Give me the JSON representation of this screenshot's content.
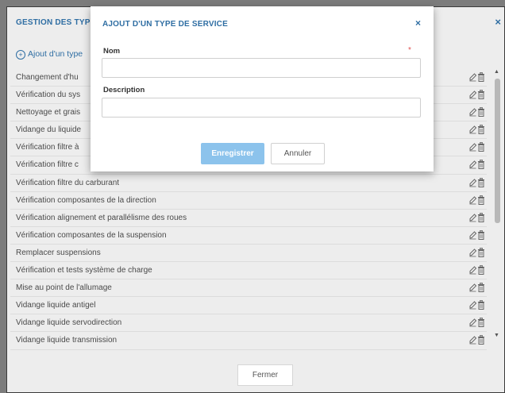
{
  "outer_dialog": {
    "title": "GESTION DES TYP",
    "close_icon": "×",
    "add_link": "Ajout d'un type",
    "close_button": "Fermer"
  },
  "service_types": [
    "Changement d'hu",
    "Vérification du sys",
    "Nettoyage et grais",
    "Vidange du liquide",
    "Vérification filtre à",
    "Vérification filtre c",
    "Vérification filtre du carburant",
    "Vérification composantes de la direction",
    "Vérification alignement et parallélisme des roues",
    "Vérification composantes de la suspension",
    "Remplacer suspensions",
    "Vérification et tests système de charge",
    "Mise au point de l'allumage",
    "Vidange liquide antigel",
    "Vidange liquide servodirection",
    "Vidange liquide transmission"
  ],
  "row_actions": {
    "edit_icon": "edit-icon",
    "delete_icon": "trash-icon"
  },
  "modal": {
    "title": "AJOUT D'UN TYPE DE SERVICE",
    "close_icon": "×",
    "name_label": "Nom",
    "required_marker": "*",
    "name_value": "",
    "description_label": "Description",
    "description_value": "",
    "save_button": "Enregistrer",
    "cancel_button": "Annuler"
  },
  "colors": {
    "accent": "#2f6ea3",
    "save_disabled": "#8cc3ec",
    "required": "#e05050",
    "backdrop": "#7c7c7c"
  }
}
